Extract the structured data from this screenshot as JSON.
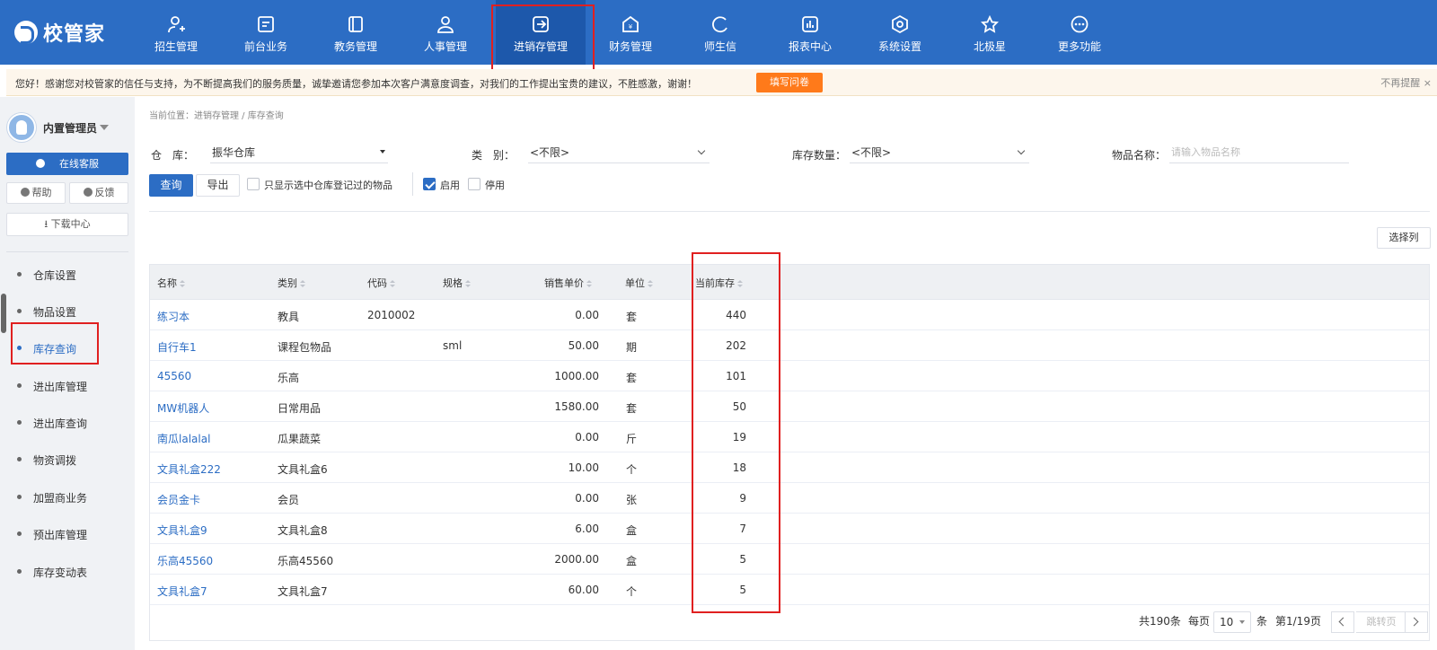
{
  "app": {
    "logo_text": "校管家"
  },
  "nav": {
    "items": [
      {
        "label": "招生管理",
        "icon": "user-add-icon"
      },
      {
        "label": "前台业务",
        "icon": "desk-icon"
      },
      {
        "label": "教务管理",
        "icon": "book-icon"
      },
      {
        "label": "人事管理",
        "icon": "person-icon"
      },
      {
        "label": "进销存管理",
        "icon": "inventory-icon"
      },
      {
        "label": "财务管理",
        "icon": "finance-icon"
      },
      {
        "label": "师生信",
        "icon": "chat-icon"
      },
      {
        "label": "报表中心",
        "icon": "report-icon"
      },
      {
        "label": "系统设置",
        "icon": "settings-icon"
      },
      {
        "label": "北极星",
        "icon": "star-icon"
      },
      {
        "label": "更多功能",
        "icon": "more-icon"
      }
    ],
    "active": "进销存管理"
  },
  "notice": {
    "text": "您好！感谢您对校管家的信任与支持，为不断提高我们的服务质量，诚挚邀请您参加本次客户满意度调查，对我们的工作提出宝贵的建议，不胜感激，谢谢！",
    "button": "填写问卷",
    "close": "不再提醒 ×"
  },
  "sidebar": {
    "user": "内置管理员",
    "online_service": "在线客服",
    "help": "帮助",
    "feedback": "反馈",
    "download_center": "下载中心",
    "items": [
      {
        "label": "仓库设置"
      },
      {
        "label": "物品设置"
      },
      {
        "label": "库存查询"
      },
      {
        "label": "进出库管理"
      },
      {
        "label": "进出库查询"
      },
      {
        "label": "物资调拨"
      },
      {
        "label": "加盟商业务"
      },
      {
        "label": "预出库管理"
      },
      {
        "label": "库存变动表"
      }
    ],
    "active": "库存查询"
  },
  "breadcrumb": "当前位置：进销存管理 / 库存查询",
  "filters": {
    "warehouse_label": "仓　库：",
    "warehouse_value": "振华仓库",
    "category_label": "类　别：",
    "category_value": "<不限>",
    "stock_label": "库存数量：",
    "stock_value": "<不限>",
    "name_label": "物品名称：",
    "name_placeholder": "请输入物品名称"
  },
  "actions": {
    "query": "查询",
    "export": "导出",
    "only_registered": "只显示选中仓库登记过的物品",
    "enabled": "启用",
    "disabled": "停用",
    "select_columns": "选择列"
  },
  "table": {
    "headers": [
      "名称",
      "类别",
      "代码",
      "规格",
      "销售单价",
      "单位",
      "当前库存"
    ],
    "rows": [
      {
        "name": "练习本",
        "category": "教具",
        "code": "2010002",
        "spec": "",
        "price": "0.00",
        "unit": "套",
        "stock": "440"
      },
      {
        "name": "自行车1",
        "category": "课程包物品",
        "code": "",
        "spec": "sml",
        "price": "50.00",
        "unit": "期",
        "stock": "202"
      },
      {
        "name": "45560",
        "category": "乐高",
        "code": "",
        "spec": "",
        "price": "1000.00",
        "unit": "套",
        "stock": "101"
      },
      {
        "name": "MW机器人",
        "category": "日常用品",
        "code": "",
        "spec": "",
        "price": "1580.00",
        "unit": "套",
        "stock": "50"
      },
      {
        "name": "南瓜lalalal",
        "category": "瓜果蔬菜",
        "code": "",
        "spec": "",
        "price": "0.00",
        "unit": "斤",
        "stock": "19"
      },
      {
        "name": "文具礼盒222",
        "category": "文具礼盒6",
        "code": "",
        "spec": "",
        "price": "10.00",
        "unit": "个",
        "stock": "18"
      },
      {
        "name": "会员金卡",
        "category": "会员",
        "code": "",
        "spec": "",
        "price": "0.00",
        "unit": "张",
        "stock": "9"
      },
      {
        "name": "文具礼盒9",
        "category": "文具礼盒8",
        "code": "",
        "spec": "",
        "price": "6.00",
        "unit": "盒",
        "stock": "7"
      },
      {
        "name": "乐高45560",
        "category": "乐高45560",
        "code": "",
        "spec": "",
        "price": "2000.00",
        "unit": "盒",
        "stock": "5"
      },
      {
        "name": "文具礼盒7",
        "category": "文具礼盒7",
        "code": "",
        "spec": "",
        "price": "60.00",
        "unit": "个",
        "stock": "5"
      }
    ]
  },
  "pagination": {
    "total": "共190条",
    "per_page_label": "每页",
    "per_page_value": "10",
    "per_page_unit": "条",
    "page_info": "第1/19页",
    "jump_placeholder": "跳转页"
  }
}
